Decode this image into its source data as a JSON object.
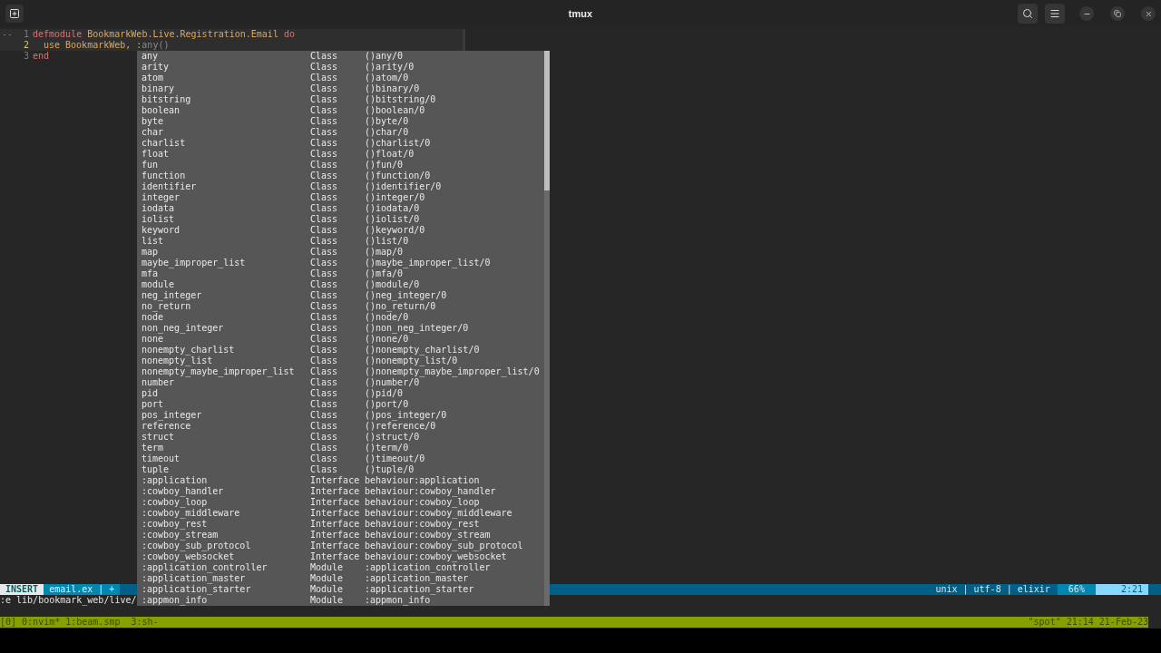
{
  "window": {
    "title": "tmux"
  },
  "editor": {
    "gutter_mark": "--",
    "lines": [
      {
        "number": "1",
        "current": false,
        "indented": false,
        "tokens": [
          {
            "kind": "keyword",
            "text": "defmodule",
            "space_before": false
          },
          {
            "kind": "module",
            "text": "BookmarkWeb.Live.Registration.Email",
            "space_before": true
          },
          {
            "kind": "keyword",
            "text": "do",
            "space_before": true
          }
        ]
      },
      {
        "number": "2",
        "current": true,
        "indented": true,
        "tokens": [
          {
            "kind": "module",
            "text": "use",
            "space_before": false
          },
          {
            "kind": "module",
            "text": "BookmarkWeb,",
            "space_before": true
          },
          {
            "kind": "atom",
            "text": ":",
            "space_before": true
          },
          {
            "kind": "ghost",
            "text": "any()",
            "space_before": false
          }
        ]
      },
      {
        "number": "3",
        "current": false,
        "indented": false,
        "tokens": [
          {
            "kind": "keyword",
            "text": "end",
            "space_before": false
          }
        ]
      }
    ]
  },
  "completion": {
    "items": [
      {
        "name": "any",
        "kind": "Class",
        "menu": "()any/0"
      },
      {
        "name": "arity",
        "kind": "Class",
        "menu": "()arity/0"
      },
      {
        "name": "atom",
        "kind": "Class",
        "menu": "()atom/0"
      },
      {
        "name": "binary",
        "kind": "Class",
        "menu": "()binary/0"
      },
      {
        "name": "bitstring",
        "kind": "Class",
        "menu": "()bitstring/0"
      },
      {
        "name": "boolean",
        "kind": "Class",
        "menu": "()boolean/0"
      },
      {
        "name": "byte",
        "kind": "Class",
        "menu": "()byte/0"
      },
      {
        "name": "char",
        "kind": "Class",
        "menu": "()char/0"
      },
      {
        "name": "charlist",
        "kind": "Class",
        "menu": "()charlist/0"
      },
      {
        "name": "float",
        "kind": "Class",
        "menu": "()float/0"
      },
      {
        "name": "fun",
        "kind": "Class",
        "menu": "()fun/0"
      },
      {
        "name": "function",
        "kind": "Class",
        "menu": "()function/0"
      },
      {
        "name": "identifier",
        "kind": "Class",
        "menu": "()identifier/0"
      },
      {
        "name": "integer",
        "kind": "Class",
        "menu": "()integer/0"
      },
      {
        "name": "iodata",
        "kind": "Class",
        "menu": "()iodata/0"
      },
      {
        "name": "iolist",
        "kind": "Class",
        "menu": "()iolist/0"
      },
      {
        "name": "keyword",
        "kind": "Class",
        "menu": "()keyword/0"
      },
      {
        "name": "list",
        "kind": "Class",
        "menu": "()list/0"
      },
      {
        "name": "map",
        "kind": "Class",
        "menu": "()map/0"
      },
      {
        "name": "maybe_improper_list",
        "kind": "Class",
        "menu": "()maybe_improper_list/0"
      },
      {
        "name": "mfa",
        "kind": "Class",
        "menu": "()mfa/0"
      },
      {
        "name": "module",
        "kind": "Class",
        "menu": "()module/0"
      },
      {
        "name": "neg_integer",
        "kind": "Class",
        "menu": "()neg_integer/0"
      },
      {
        "name": "no_return",
        "kind": "Class",
        "menu": "()no_return/0"
      },
      {
        "name": "node",
        "kind": "Class",
        "menu": "()node/0"
      },
      {
        "name": "non_neg_integer",
        "kind": "Class",
        "menu": "()non_neg_integer/0"
      },
      {
        "name": "none",
        "kind": "Class",
        "menu": "()none/0"
      },
      {
        "name": "nonempty_charlist",
        "kind": "Class",
        "menu": "()nonempty_charlist/0"
      },
      {
        "name": "nonempty_list",
        "kind": "Class",
        "menu": "()nonempty_list/0"
      },
      {
        "name": "nonempty_maybe_improper_list",
        "kind": "Class",
        "menu": "()nonempty_maybe_improper_list/0"
      },
      {
        "name": "number",
        "kind": "Class",
        "menu": "()number/0"
      },
      {
        "name": "pid",
        "kind": "Class",
        "menu": "()pid/0"
      },
      {
        "name": "port",
        "kind": "Class",
        "menu": "()port/0"
      },
      {
        "name": "pos_integer",
        "kind": "Class",
        "menu": "()pos_integer/0"
      },
      {
        "name": "reference",
        "kind": "Class",
        "menu": "()reference/0"
      },
      {
        "name": "struct",
        "kind": "Class",
        "menu": "()struct/0"
      },
      {
        "name": "term",
        "kind": "Class",
        "menu": "()term/0"
      },
      {
        "name": "timeout",
        "kind": "Class",
        "menu": "()timeout/0"
      },
      {
        "name": "tuple",
        "kind": "Class",
        "menu": "()tuple/0"
      },
      {
        "name": ":application",
        "kind": "Interface",
        "menu": "behaviour:application"
      },
      {
        "name": ":cowboy_handler",
        "kind": "Interface",
        "menu": "behaviour:cowboy_handler"
      },
      {
        "name": ":cowboy_loop",
        "kind": "Interface",
        "menu": "behaviour:cowboy_loop"
      },
      {
        "name": ":cowboy_middleware",
        "kind": "Interface",
        "menu": "behaviour:cowboy_middleware"
      },
      {
        "name": ":cowboy_rest",
        "kind": "Interface",
        "menu": "behaviour:cowboy_rest"
      },
      {
        "name": ":cowboy_stream",
        "kind": "Interface",
        "menu": "behaviour:cowboy_stream"
      },
      {
        "name": ":cowboy_sub_protocol",
        "kind": "Interface",
        "menu": "behaviour:cowboy_sub_protocol"
      },
      {
        "name": ":cowboy_websocket",
        "kind": "Interface",
        "menu": "behaviour:cowboy_websocket"
      },
      {
        "name": ":application_controller",
        "kind": "Module",
        "menu": ":application_controller"
      },
      {
        "name": ":application_master",
        "kind": "Module",
        "menu": ":application_master"
      },
      {
        "name": ":application_starter",
        "kind": "Module",
        "menu": ":application_starter"
      },
      {
        "name": ":appmon_info",
        "kind": "Module",
        "menu": ":appmon_info"
      }
    ]
  },
  "statusline": {
    "mode": "INSERT",
    "file": "email.ex | +",
    "info": "unix | utf-8 | elixir",
    "percent": "66%",
    "position": "2:21"
  },
  "command_line": ":e lib/bookmark_web/live/",
  "tmux_status": {
    "left": "[0] 0:nvim* 1:beam.smp  3:sh-",
    "right": "\"spot\" 21:14 21-Feb-23"
  }
}
